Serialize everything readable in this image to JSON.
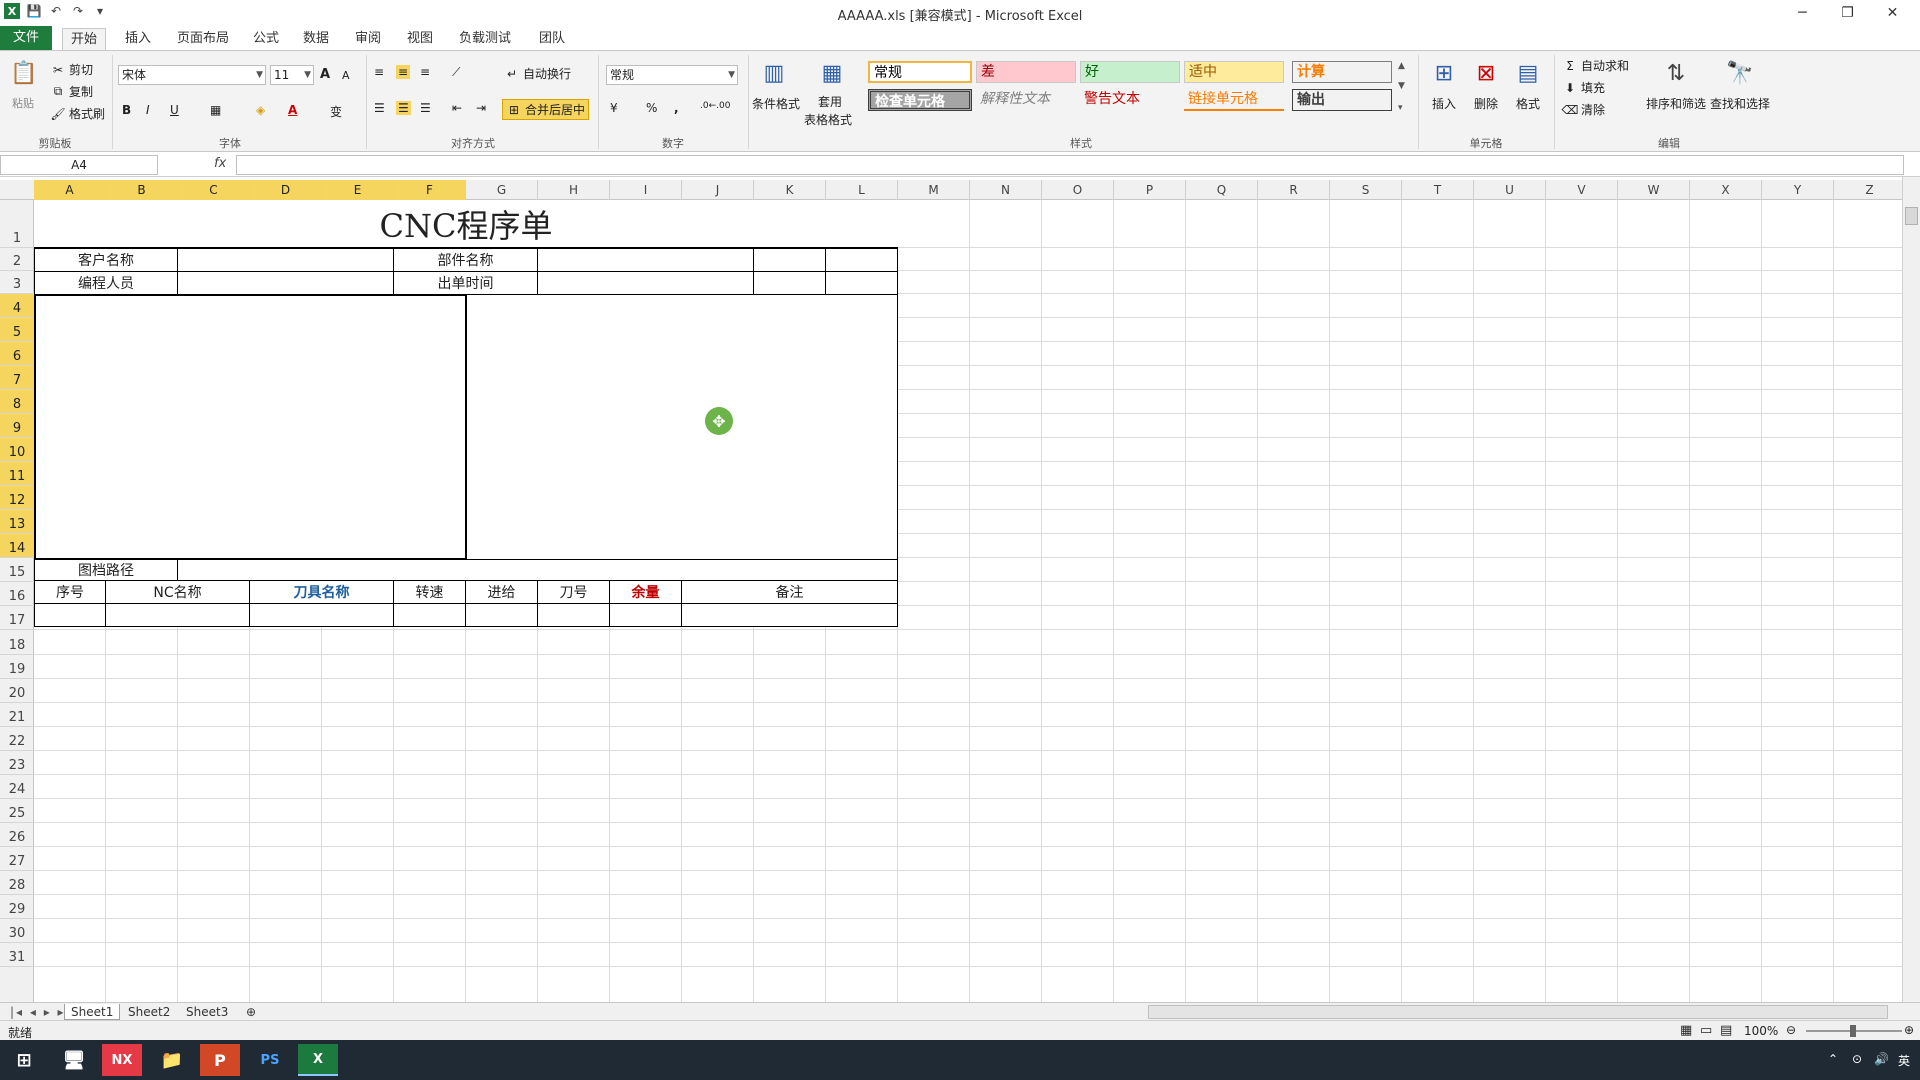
{
  "window": {
    "title": "AAAAA.xls  [兼容模式]  -  Microsoft Excel",
    "minimize": "─",
    "restore": "❐",
    "close": "✕"
  },
  "qat": {
    "logo": "X",
    "save": "💾",
    "undo": "↶",
    "redo": "↷",
    "customize": "▾"
  },
  "tabs": [
    "文件",
    "开始",
    "插入",
    "页面布局",
    "公式",
    "数据",
    "审阅",
    "视图",
    "负载测试",
    "团队"
  ],
  "ribbon": {
    "clipboard": {
      "paste": "粘贴",
      "cut": "剪切",
      "copy": "复制",
      "format_painter": "格式刷",
      "label": "剪贴板"
    },
    "font": {
      "name": "宋体",
      "size": "11",
      "bold": "B",
      "italic": "I",
      "underline": "U",
      "label": "字体",
      "grow": "A",
      "shrink": "A",
      "wen": "变",
      "font_color_glyph": "A"
    },
    "alignment": {
      "wrap": "自动换行",
      "merge": "合并后居中",
      "label": "对齐方式"
    },
    "number": {
      "format": "常规",
      "percent": "%",
      "comma": ",",
      "label": "数字",
      "inc_dec": ".0←.00",
      "dec_dec": ".00→.0"
    },
    "styles": {
      "conditional": "条件格式",
      "table_format_line1": "套用",
      "table_format_line2": "表格格式",
      "cells": [
        "常规",
        "差",
        "好",
        "适中",
        "计算",
        "检查单元格",
        "解释性文本",
        "警告文本",
        "链接单元格",
        "输出"
      ],
      "label": "样式"
    },
    "cells": {
      "insert": "插入",
      "delete": "删除",
      "format": "格式",
      "label": "单元格"
    },
    "editing": {
      "autosum": "自动求和",
      "fill": "填充",
      "clear": "清除",
      "sort": "排序和筛选",
      "find": "查找和选择",
      "label": "编辑"
    }
  },
  "formula_bar": {
    "name_box": "A4",
    "fx": "fx",
    "value": ""
  },
  "columns": [
    "A",
    "B",
    "C",
    "D",
    "E",
    "F",
    "G",
    "H",
    "I",
    "J",
    "K",
    "L",
    "M",
    "N",
    "O",
    "P",
    "Q",
    "R",
    "S",
    "T",
    "U",
    "V",
    "W",
    "X",
    "Y",
    "Z"
  ],
  "rows": [
    "1",
    "2",
    "3",
    "4",
    "5",
    "6",
    "7",
    "8",
    "9",
    "10",
    "11",
    "12",
    "13",
    "14",
    "15",
    "16",
    "17",
    "18",
    "19",
    "20",
    "21",
    "22",
    "23",
    "24",
    "25",
    "26",
    "27",
    "28",
    "29",
    "30",
    "31"
  ],
  "form": {
    "title": "CNC程序单",
    "customer_label": "客户名称",
    "part_label": "部件名称",
    "programmer_label": "编程人员",
    "issue_time_label": "出单时间",
    "drawing_path_label": "图档路径",
    "table_headers": {
      "seq": "序号",
      "nc_name": "NC名称",
      "tool_name": "刀具名称",
      "speed": "转速",
      "feed": "进给",
      "tool_no": "刀号",
      "allowance": "余量",
      "note": "备注"
    },
    "tool_name_color": "#1f5f9e",
    "allowance_color": "#c00000"
  },
  "sheet_tabs": [
    "Sheet1",
    "Sheet2",
    "Sheet3"
  ],
  "status": {
    "ready": "就绪",
    "zoom": "100%"
  },
  "taskbar": {
    "ime": "英",
    "apps": [
      "NX",
      "PS",
      "X"
    ]
  }
}
